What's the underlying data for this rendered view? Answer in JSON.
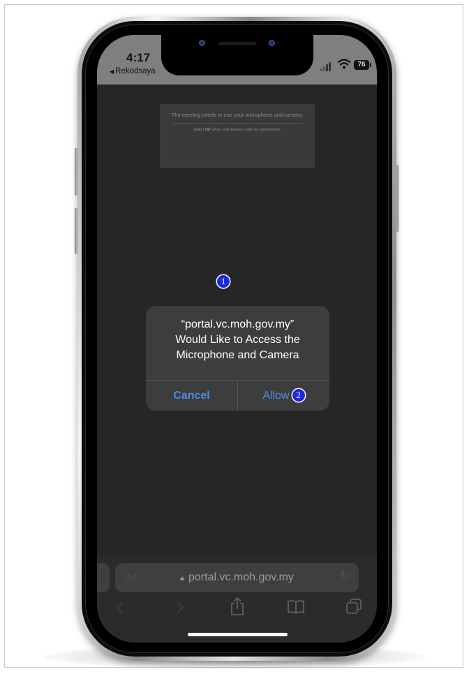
{
  "status_bar": {
    "time": "4:17",
    "back_app": "Rekodsaya",
    "battery": "76"
  },
  "page_notice": {
    "line1": "The meeting needs to use your microphone and camera.",
    "line2_prefix": "Select ",
    "line2_bold": "OK",
    "line2_suffix": " when your browser asks for permissions."
  },
  "dialog": {
    "title_line1": "“portal.vc.moh.gov.my”",
    "title_line2": "Would Like to Access the",
    "title_line3": "Microphone and Camera",
    "cancel_label": "Cancel",
    "allow_label": "Allow"
  },
  "annotations": {
    "badge_1": "1",
    "badge_2": "2",
    "badge_color": "#1f29d9"
  },
  "address_bar": {
    "text_size_label": "AA",
    "url": "portal.vc.moh.gov.my"
  },
  "icons": {
    "back": "chevron-left-icon",
    "forward": "chevron-right-icon",
    "share": "share-icon",
    "bookmarks": "book-icon",
    "tabs": "tabs-icon",
    "lock": "lock-icon",
    "reload": "reload-icon"
  },
  "colors": {
    "accent": "#4a8ee8",
    "screen_bg": "#262626",
    "dialog_bg": "#3d3d3d"
  }
}
